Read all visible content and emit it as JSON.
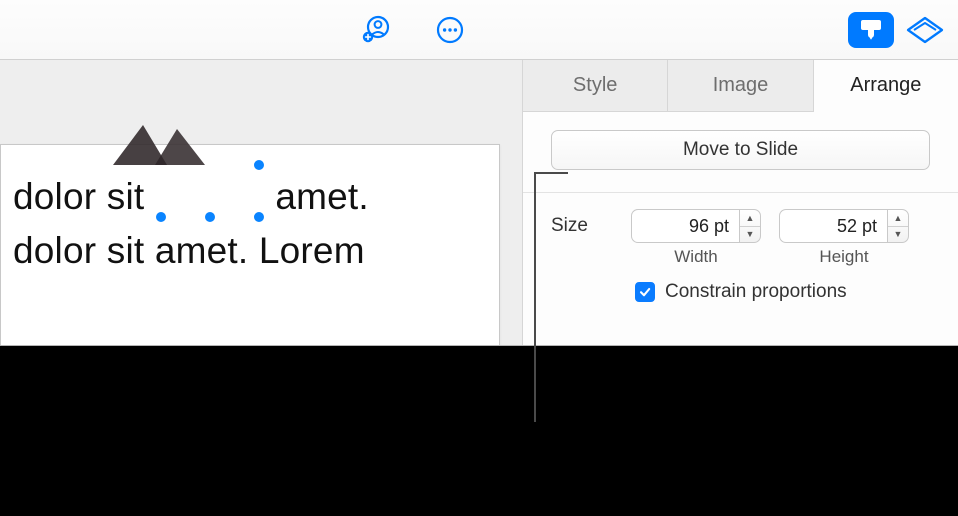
{
  "toolbar": {
    "collaborate_icon": "collaborate-icon",
    "more_icon": "more-icon",
    "format_icon": "format-icon",
    "animate_icon": "animate-icon"
  },
  "slide": {
    "text_before": "dolor sit",
    "text_after": "amet.",
    "line2": "dolor sit amet. Lorem"
  },
  "inspector": {
    "tabs": {
      "style": "Style",
      "image": "Image",
      "arrange": "Arrange"
    },
    "move_button": "Move to Slide",
    "size_label": "Size",
    "width": {
      "value": "96 pt",
      "label": "Width"
    },
    "height": {
      "value": "52 pt",
      "label": "Height"
    },
    "constrain": {
      "checked": true,
      "label": "Constrain proportions"
    }
  }
}
